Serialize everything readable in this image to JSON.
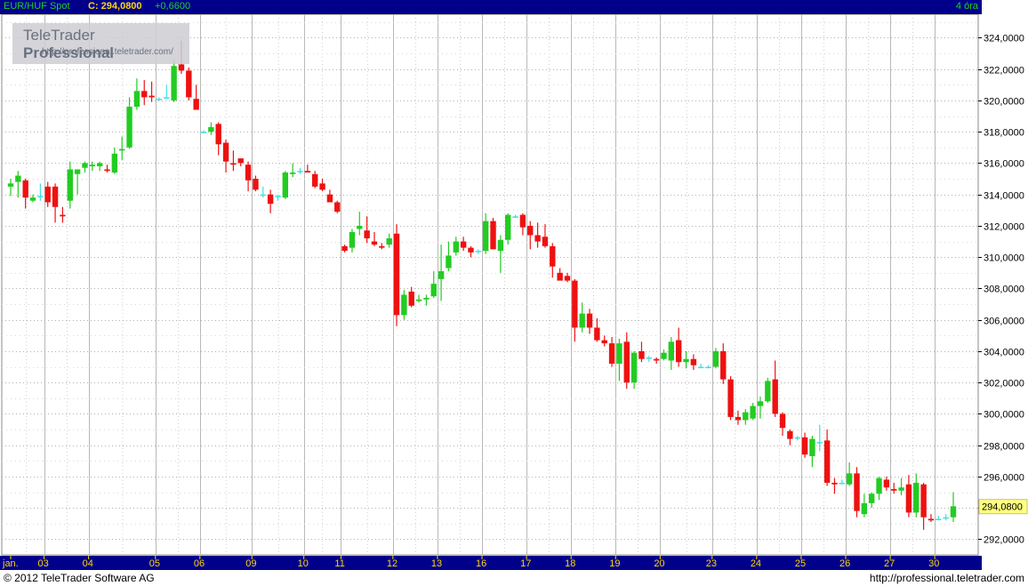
{
  "header": {
    "title": "EUR/HUF Spot",
    "close": "C: 294,0800",
    "change": "+0,6600",
    "interval": "4 óra"
  },
  "watermark": {
    "brand_regular": "TeleTrader ",
    "brand_bold": "Professional",
    "site": "http://professional.teletrader.com/"
  },
  "footer": {
    "copyright": "© 2012  TeleTrader Software AG",
    "url": "http://professional.teletrader.com"
  },
  "colors": {
    "up": "#22cc22",
    "down": "#ee1111",
    "doji": "#40e0e0",
    "axis_bg": "#00008b",
    "axis_text": "#ffd800",
    "last_price_bg": "#ffff80"
  },
  "chart_data": {
    "type": "candlestick",
    "x_tick_labels": [
      "jan.",
      "03",
      "04",
      "05",
      "06",
      "09",
      "10",
      "11",
      "12",
      "13",
      "16",
      "17",
      "18",
      "19",
      "20",
      "23",
      "24",
      "25",
      "26",
      "27",
      "30"
    ],
    "y_tick_labels": [
      "324,0000",
      "322,0000",
      "320,0000",
      "318,0000",
      "316,0000",
      "314,0000",
      "312,0000",
      "310,0000",
      "308,0000",
      "306,0000",
      "304,0000",
      "302,0000",
      "300,0000",
      "298,0000",
      "296,0000",
      "294,0000",
      "292,0000"
    ],
    "ylim": [
      291,
      325.5
    ],
    "last_price": 294.08,
    "last_price_label": "294,0800",
    "grid": true,
    "days": [
      {
        "label": "jan.",
        "ohlc": [
          [
            314.5,
            315.0,
            313.9,
            314.7
          ],
          [
            314.8,
            315.5,
            313.8,
            315.2
          ],
          [
            314.9,
            315.0,
            313.1,
            313.8
          ],
          [
            313.6,
            314.0,
            313.5,
            313.8
          ],
          [
            313.9,
            314.7,
            313.6,
            313.9
          ]
        ]
      },
      {
        "label": "03",
        "ohlc": [
          [
            314.5,
            314.8,
            313.2,
            313.5
          ],
          [
            314.5,
            314.7,
            312.2,
            313.2
          ],
          [
            312.7,
            313.2,
            312.2,
            312.6
          ],
          [
            313.6,
            316.1,
            313.1,
            315.6
          ],
          [
            315.3,
            315.6,
            314.0,
            315.6
          ],
          [
            315.7,
            316.1,
            315.4,
            316.0
          ]
        ]
      },
      {
        "label": "04",
        "ohlc": [
          [
            315.8,
            316.1,
            315.5,
            315.9
          ],
          [
            315.8,
            316.1,
            315.5,
            316.0
          ],
          [
            315.6,
            315.9,
            315.4,
            315.5
          ],
          [
            315.4,
            317.0,
            315.3,
            316.6
          ],
          [
            316.8,
            317.7,
            316.2,
            316.9
          ],
          [
            317.0,
            320.2,
            316.9,
            319.6
          ],
          [
            319.6,
            321.4,
            319.4,
            320.6
          ],
          [
            320.6,
            321.3,
            319.7,
            320.2
          ],
          [
            320.3,
            321.2,
            319.9,
            320.2
          ]
        ]
      },
      {
        "label": "05",
        "ohlc": [
          [
            320.1,
            320.2,
            320.0,
            320.1
          ],
          [
            320.2,
            321.0,
            320.1,
            320.2
          ],
          [
            320.0,
            322.6,
            319.9,
            322.2
          ],
          [
            322.3,
            323.8,
            321.7,
            321.9
          ],
          [
            321.9,
            322.1,
            320.0,
            320.2
          ],
          [
            320.1,
            321.0,
            319.4,
            319.4
          ]
        ]
      },
      {
        "label": "06",
        "ohlc": [
          [
            318.0,
            318.1,
            317.9,
            318.0
          ],
          [
            318.0,
            318.6,
            317.8,
            318.3
          ],
          [
            318.5,
            318.6,
            316.5,
            317.2
          ],
          [
            317.3,
            317.5,
            315.4,
            316.1
          ],
          [
            316.0,
            316.8,
            315.5,
            315.9
          ],
          [
            316.3,
            316.3,
            315.8,
            316.0
          ],
          [
            315.9,
            316.1,
            314.2,
            314.9
          ]
        ]
      },
      {
        "label": "09",
        "ohlc": [
          [
            315.0,
            315.2,
            314.2,
            314.3
          ],
          [
            314.0,
            314.5,
            313.8,
            314.0
          ],
          [
            314.0,
            314.3,
            312.8,
            313.4
          ],
          [
            313.9,
            314.0,
            313.6,
            313.9
          ],
          [
            313.8,
            315.5,
            313.7,
            315.4
          ],
          [
            315.3,
            316.0,
            315.1,
            315.4
          ],
          [
            315.5,
            315.7,
            315.3,
            315.5
          ]
        ]
      },
      {
        "label": "10",
        "ohlc": [
          [
            315.5,
            315.9,
            315.4,
            315.4
          ],
          [
            315.3,
            315.5,
            314.4,
            314.5
          ],
          [
            314.7,
            315.0,
            314.2,
            314.3
          ],
          [
            314.0,
            314.3,
            313.5,
            313.5
          ],
          [
            313.5,
            313.6,
            312.8,
            312.9
          ]
        ]
      },
      {
        "label": "11",
        "ohlc": [
          [
            310.7,
            310.8,
            310.3,
            310.4
          ],
          [
            310.6,
            311.8,
            310.3,
            311.6
          ],
          [
            311.8,
            312.9,
            311.4,
            312.0
          ],
          [
            311.7,
            312.6,
            310.9,
            311.2
          ],
          [
            311.0,
            311.6,
            310.7,
            310.8
          ],
          [
            310.7,
            310.9,
            310.5,
            310.6
          ],
          [
            310.8,
            311.5,
            310.6,
            311.2
          ]
        ]
      },
      {
        "label": "12",
        "ohlc": [
          [
            311.5,
            312.1,
            305.6,
            306.3
          ],
          [
            306.3,
            307.9,
            306.0,
            307.6
          ],
          [
            307.8,
            308.1,
            306.8,
            306.9
          ],
          [
            307.2,
            307.6,
            307.1,
            307.3
          ],
          [
            307.3,
            307.6,
            306.9,
            307.4
          ],
          [
            307.5,
            309.1,
            307.4,
            308.3
          ]
        ]
      },
      {
        "label": "13",
        "ohlc": [
          [
            308.6,
            310.8,
            307.2,
            309.1
          ],
          [
            309.3,
            311.0,
            309.1,
            310.1
          ],
          [
            310.3,
            311.3,
            310.1,
            311.0
          ],
          [
            311.0,
            311.3,
            310.4,
            310.6
          ],
          [
            310.6,
            310.7,
            310.0,
            310.3
          ],
          [
            310.4,
            310.5,
            310.2,
            310.4
          ]
        ]
      },
      {
        "label": "16",
        "ohlc": [
          [
            310.4,
            312.8,
            310.2,
            312.3
          ],
          [
            312.3,
            312.5,
            310.5,
            310.5
          ],
          [
            310.4,
            311.4,
            309.0,
            311.1
          ],
          [
            311.1,
            312.8,
            310.8,
            312.7
          ],
          [
            312.6,
            312.7,
            312.5,
            312.6
          ],
          [
            312.7,
            312.8,
            311.4,
            311.9
          ]
        ]
      },
      {
        "label": "17",
        "ohlc": [
          [
            312.0,
            312.3,
            310.5,
            311.4
          ],
          [
            311.4,
            312.2,
            310.6,
            311.0
          ],
          [
            311.3,
            312.1,
            310.6,
            310.7
          ],
          [
            310.7,
            310.9,
            308.7,
            309.4
          ],
          [
            309.0,
            309.3,
            308.6,
            308.5
          ],
          [
            308.8,
            309.0,
            308.4,
            308.5
          ]
        ]
      },
      {
        "label": "18",
        "ohlc": [
          [
            308.5,
            308.6,
            304.6,
            305.5
          ],
          [
            305.5,
            307.1,
            305.2,
            306.4
          ],
          [
            306.4,
            306.7,
            305.1,
            305.5
          ],
          [
            305.5,
            306.1,
            304.6,
            304.7
          ],
          [
            304.7,
            305.0,
            304.3,
            304.5
          ],
          [
            304.5,
            304.9,
            303.0,
            303.2
          ]
        ]
      },
      {
        "label": "19",
        "ohlc": [
          [
            303.2,
            304.8,
            302.1,
            304.5
          ],
          [
            304.6,
            305.2,
            301.6,
            302.0
          ],
          [
            302.0,
            304.0,
            301.6,
            303.9
          ],
          [
            304.0,
            304.6,
            303.3,
            303.5
          ],
          [
            303.6,
            303.7,
            303.3,
            303.6
          ],
          [
            303.5,
            303.6,
            303.2,
            303.4
          ]
        ]
      },
      {
        "label": "20",
        "ohlc": [
          [
            303.5,
            304.1,
            303.4,
            303.9
          ],
          [
            303.4,
            304.9,
            302.8,
            304.6
          ],
          [
            304.7,
            305.5,
            303.0,
            303.3
          ],
          [
            303.3,
            304.0,
            302.9,
            303.5
          ],
          [
            303.5,
            303.8,
            302.8,
            303.1
          ],
          [
            303.0,
            303.2,
            302.9,
            303.0
          ],
          [
            303.0,
            303.1,
            302.9,
            303.0
          ]
        ]
      },
      {
        "label": "23",
        "ohlc": [
          [
            303.0,
            304.2,
            302.9,
            304.0
          ],
          [
            304.0,
            304.5,
            301.9,
            302.2
          ],
          [
            302.2,
            302.4,
            299.6,
            299.8
          ],
          [
            299.8,
            300.2,
            299.3,
            299.6
          ],
          [
            299.6,
            300.3,
            299.3,
            300.1
          ],
          [
            299.7,
            300.7,
            299.6,
            300.5
          ]
        ]
      },
      {
        "label": "24",
        "ohlc": [
          [
            300.5,
            301.1,
            299.7,
            300.8
          ],
          [
            300.8,
            302.3,
            300.7,
            302.1
          ],
          [
            302.2,
            303.4,
            299.8,
            300.0
          ],
          [
            300.0,
            300.1,
            298.6,
            299.1
          ],
          [
            298.9,
            299.0,
            298.0,
            298.4
          ],
          [
            298.5,
            298.6,
            298.3,
            298.5
          ]
        ]
      },
      {
        "label": "25",
        "ohlc": [
          [
            298.5,
            298.8,
            297.2,
            297.4
          ],
          [
            297.3,
            298.6,
            296.6,
            298.4
          ],
          [
            298.2,
            299.3,
            297.6,
            298.2
          ],
          [
            298.3,
            299.0,
            295.4,
            295.6
          ],
          [
            295.6,
            295.9,
            294.9,
            295.5
          ],
          [
            295.6,
            295.8,
            295.5,
            295.6
          ]
        ]
      },
      {
        "label": "26",
        "ohlc": [
          [
            295.5,
            296.9,
            295.4,
            296.2
          ],
          [
            296.2,
            296.6,
            293.4,
            293.8
          ],
          [
            293.6,
            294.9,
            293.4,
            294.3
          ],
          [
            294.3,
            295.0,
            294.0,
            294.9
          ],
          [
            294.9,
            296.0,
            294.5,
            295.9
          ],
          [
            295.8,
            296.0,
            295.1,
            295.3
          ]
        ]
      },
      {
        "label": "27",
        "ohlc": [
          [
            295.2,
            295.6,
            294.9,
            295.1
          ],
          [
            295.1,
            295.9,
            294.8,
            295.3
          ],
          [
            295.5,
            296.1,
            293.4,
            293.7
          ],
          [
            293.7,
            296.2,
            293.4,
            295.6
          ],
          [
            295.5,
            295.6,
            292.6,
            293.4
          ],
          [
            293.3,
            293.6,
            293.1,
            293.2
          ]
        ]
      },
      {
        "label": "30",
        "ohlc": [
          [
            293.3,
            293.5,
            293.2,
            293.3
          ],
          [
            293.4,
            293.6,
            293.2,
            293.4
          ],
          [
            293.4,
            295.0,
            293.1,
            294.1
          ]
        ]
      }
    ]
  }
}
